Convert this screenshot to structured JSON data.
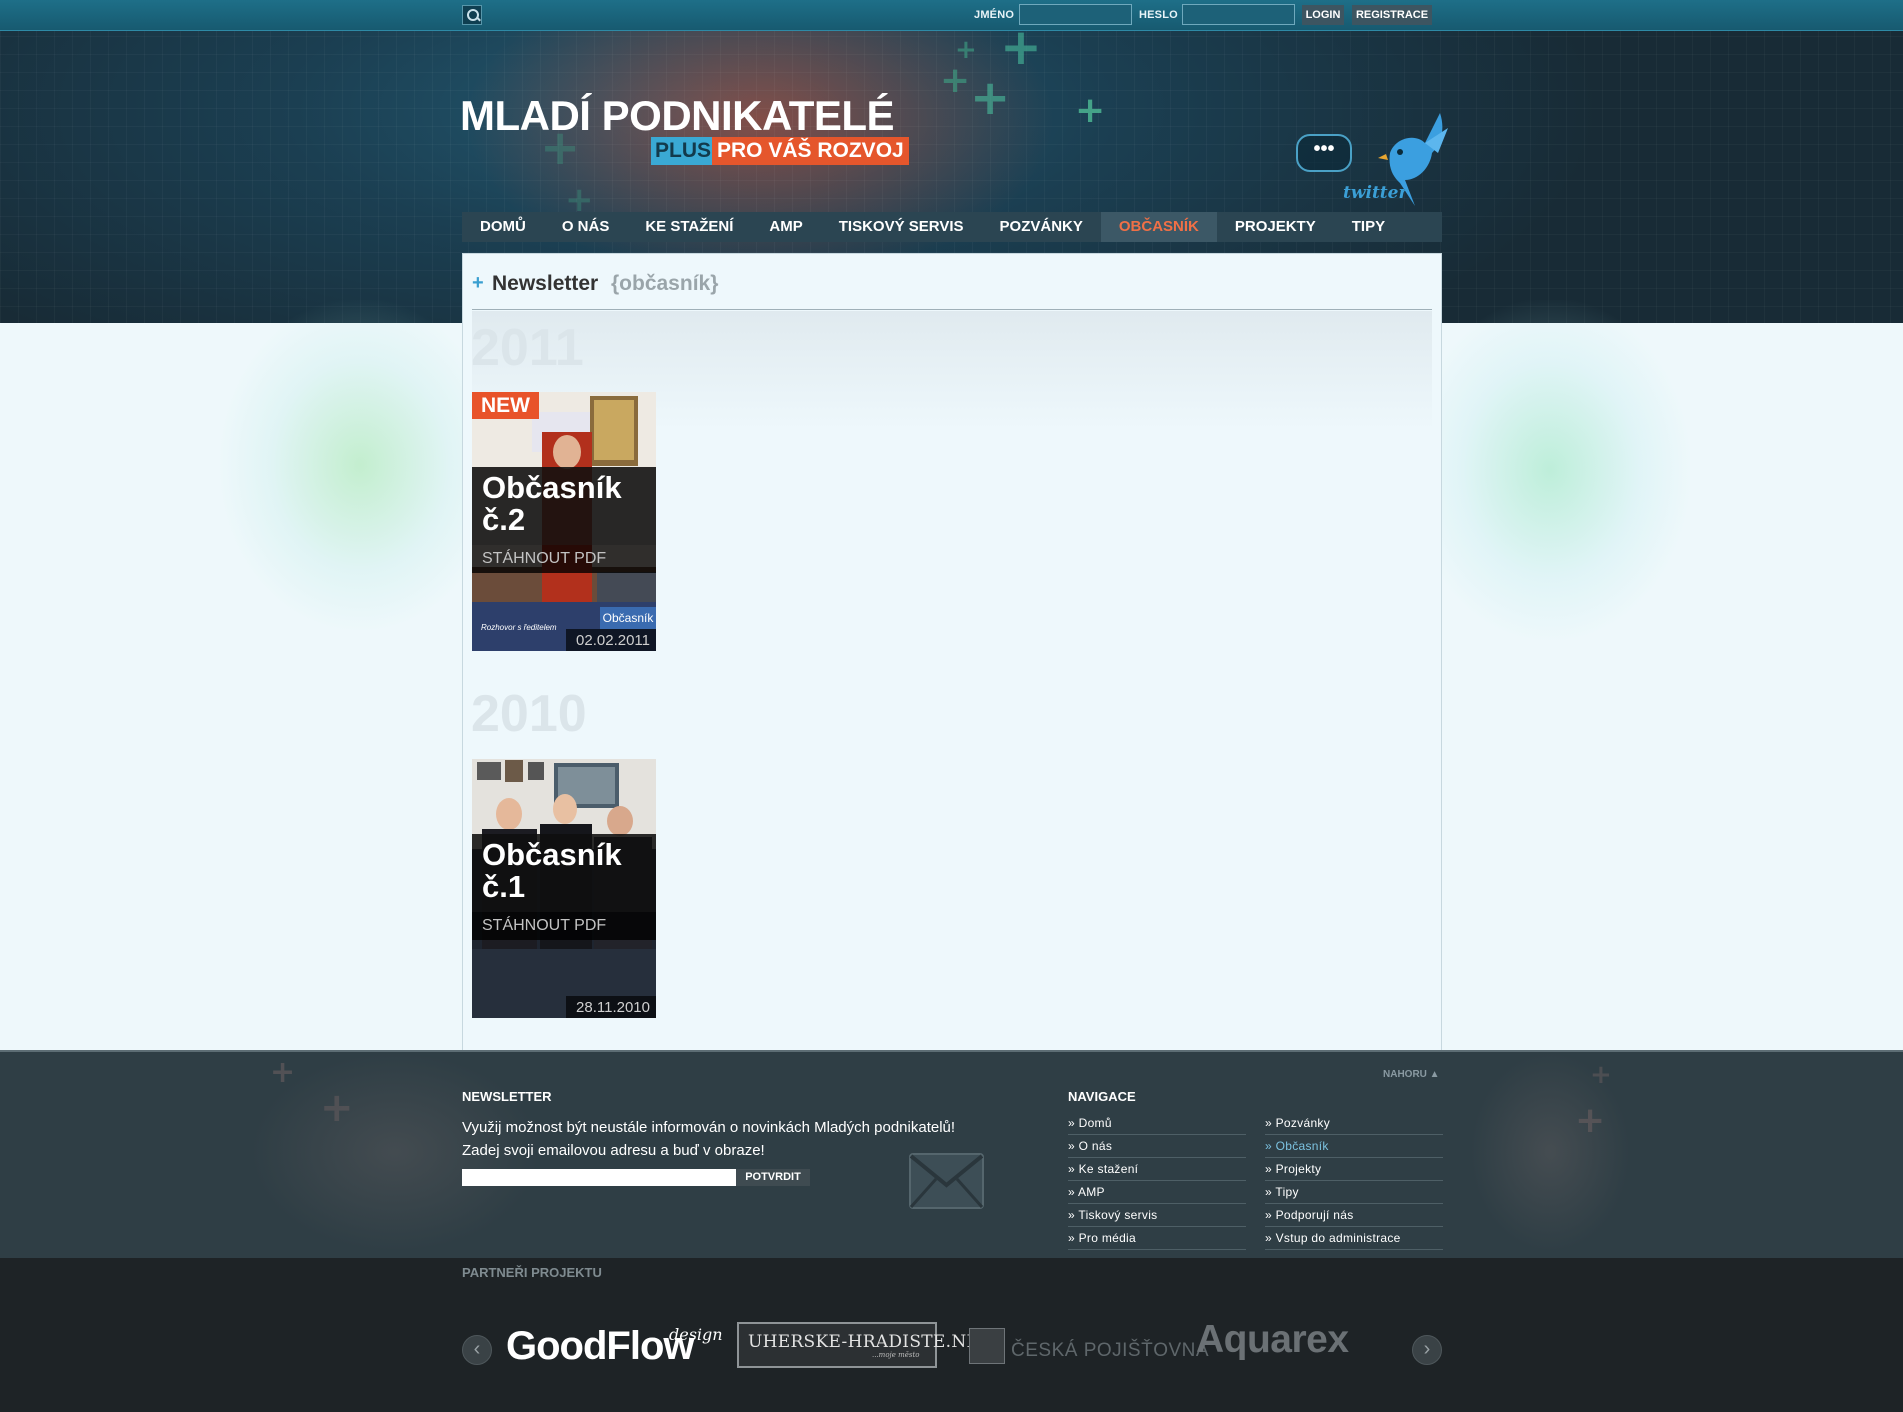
{
  "topbar": {
    "name_label": "JMÉNO",
    "password_label": "HESLO",
    "login_label": "LOGIN",
    "register_label": "REGISTRACE"
  },
  "logo": {
    "title": "MLADÍ PODNIKATELÉ",
    "plus": "PLUS",
    "tagline": "PRO VÁŠ ROZVOJ"
  },
  "twitter": {
    "bubble": "•••",
    "label": "twitter"
  },
  "nav": {
    "items": [
      {
        "label": "DOMŮ"
      },
      {
        "label": "O NÁS"
      },
      {
        "label": "KE STAŽENÍ"
      },
      {
        "label": "AMP"
      },
      {
        "label": "TISKOVÝ SERVIS"
      },
      {
        "label": "POZVÁNKY"
      },
      {
        "label": "OBČASNÍK"
      },
      {
        "label": "PROJEKTY"
      },
      {
        "label": "TIPY"
      }
    ],
    "active_index": 6
  },
  "page": {
    "title": "Newsletter",
    "subtitle": "{občasník}"
  },
  "years": [
    {
      "year": "2011",
      "issues": [
        {
          "badge": "NEW",
          "title": "Občasník č.2",
          "download": "STÁHNOUT PDF",
          "date": "02.02.2011"
        }
      ]
    },
    {
      "year": "2010",
      "issues": [
        {
          "title": "Občasník č.1",
          "download": "STÁHNOUT PDF",
          "date": "28.11.2010"
        }
      ]
    }
  ],
  "footer": {
    "newsletter": {
      "heading": "NEWSLETTER",
      "text_line1": "Využij možnost být neustále informován o novinkách Mladých podnikatelů!",
      "text_line2": "Zadej svoji emailovou adresu a buď v obraze!",
      "submit_label": "POTVRDIT"
    },
    "back_to_top": "NAHORU ▲",
    "navigation": {
      "heading": "NAVIGACE",
      "col1": [
        "» Domů",
        "» O nás",
        "» Ke stažení",
        "» AMP",
        "» Tiskový servis",
        "» Pro média"
      ],
      "col2": [
        "» Pozvánky",
        "» Občasník",
        "» Projekty",
        "» Tipy",
        "» Podporují nás",
        "» Vstup do administrace"
      ]
    }
  },
  "partners": {
    "heading": "PARTNEŘI PROJEKTU",
    "logos": {
      "goodflow": "GoodFlow",
      "goodflow_sup": "design",
      "uh": "UHERSKE-HRADISTE.NET",
      "uh_sub": "...moje město",
      "cp": "ČESKÁ POJIŠŤOVNA",
      "aquarex": "Aquarex"
    }
  },
  "colors": {
    "accent_orange": "#e8532a",
    "accent_blue": "#3aa9d4",
    "nav_bg": "#2b4552",
    "footer_bg": "#2f3e45"
  }
}
